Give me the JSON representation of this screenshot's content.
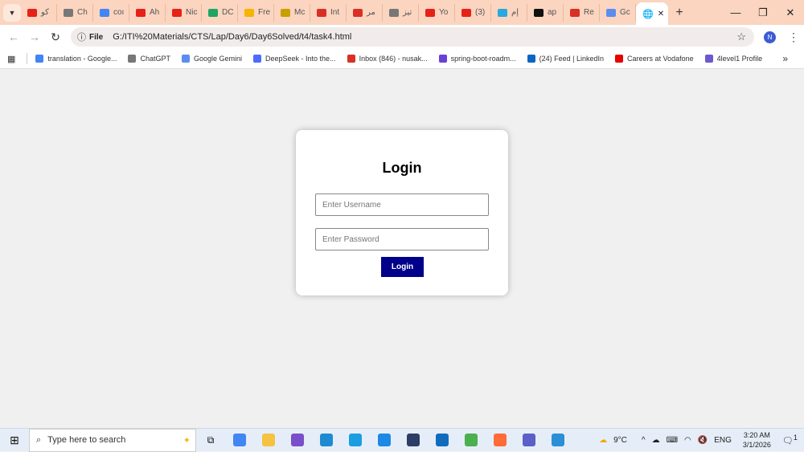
{
  "browser": {
    "tabs": [
      {
        "label": "كو",
        "icon": "youtube-icon",
        "color": "#e62117"
      },
      {
        "label": "Ch",
        "icon": "chatgpt-icon",
        "color": "#777777"
      },
      {
        "label": "coı",
        "icon": "google-icon",
        "color": "#4285f4"
      },
      {
        "label": "Ah",
        "icon": "youtube-icon",
        "color": "#e62117"
      },
      {
        "label": "Nic",
        "icon": "youtube-icon",
        "color": "#e62117"
      },
      {
        "label": "DC",
        "icon": "sheets-icon",
        "color": "#1fa463"
      },
      {
        "label": "Fre",
        "icon": "drive-icon",
        "color": "#f4b400"
      },
      {
        "label": "Mc",
        "icon": "pin-icon",
        "color": "#c9a000"
      },
      {
        "label": "Int",
        "icon": "gmail-icon",
        "color": "#d93025"
      },
      {
        "label": "مر",
        "icon": "gmail-icon",
        "color": "#d93025"
      },
      {
        "label": "تيز",
        "icon": "chatgpt-icon",
        "color": "#777777"
      },
      {
        "label": "Yo",
        "icon": "youtube-icon",
        "color": "#e62117"
      },
      {
        "label": "(3)",
        "icon": "youtube-icon",
        "color": "#e62117"
      },
      {
        "label": "إم",
        "icon": "circle-icon",
        "color": "#29a8e0"
      },
      {
        "label": "ap",
        "icon": "github-icon",
        "color": "#111111"
      },
      {
        "label": "Re",
        "icon": "gmail-icon",
        "color": "#d93025"
      },
      {
        "label": "Gc",
        "icon": "gemini-icon",
        "color": "#5b8def"
      }
    ],
    "active_tab_close": "✕",
    "new_tab": "+",
    "address_chip": "File",
    "url": "G:/ITI%20Materials/CTS/Lap/Day6/Day6Solved/t4/task4.html",
    "profile_initial": "N",
    "bookmarks": [
      {
        "label": "translation - Google...",
        "icon": "google-icon",
        "color": "#4285f4"
      },
      {
        "label": "ChatGPT",
        "icon": "chatgpt-icon",
        "color": "#777777"
      },
      {
        "label": "Google Gemini",
        "icon": "gemini-icon",
        "color": "#5b8def"
      },
      {
        "label": "DeepSeek - Into the...",
        "icon": "deepseek-icon",
        "color": "#4d6bfe"
      },
      {
        "label": "Inbox (846) - nusak...",
        "icon": "gmail-icon",
        "color": "#d93025"
      },
      {
        "label": "spring-boot-roadm...",
        "icon": "roadmap-icon",
        "color": "#6b3fd6"
      },
      {
        "label": "(24) Feed | LinkedIn",
        "icon": "linkedin-icon",
        "color": "#0a66c2"
      },
      {
        "label": "Careers at Vodafone",
        "icon": "vodafone-icon",
        "color": "#e60000"
      },
      {
        "label": "4level1 Profile",
        "icon": "page-icon",
        "color": "#6a5acd"
      }
    ]
  },
  "login": {
    "title": "Login",
    "username_placeholder": "Enter Username",
    "password_placeholder": "Enter Password",
    "button": "Login",
    "button_color": "#00008b"
  },
  "taskbar": {
    "search_placeholder": "Type here to search",
    "apps": [
      {
        "name": "chrome",
        "color": "#4285f4"
      },
      {
        "name": "file-explorer",
        "color": "#f5c242"
      },
      {
        "name": "visual-studio",
        "color": "#7b4fc9"
      },
      {
        "name": "vscode",
        "color": "#1f8ad2"
      },
      {
        "name": "edge",
        "color": "#1b9de2"
      },
      {
        "name": "database",
        "color": "#1e88e5"
      },
      {
        "name": "dark-app",
        "color": "#2c3e66"
      },
      {
        "name": "outlook",
        "color": "#0f6cbd"
      },
      {
        "name": "spring",
        "color": "#4caf50"
      },
      {
        "name": "postman",
        "color": "#ff6c37"
      },
      {
        "name": "teams",
        "color": "#5b5fc7"
      },
      {
        "name": "photos",
        "color": "#2a8fd6"
      }
    ],
    "weather": "9°C",
    "language": "ENG",
    "time": "3:20 AM",
    "date": "3/1/2026",
    "notifications": "1"
  }
}
